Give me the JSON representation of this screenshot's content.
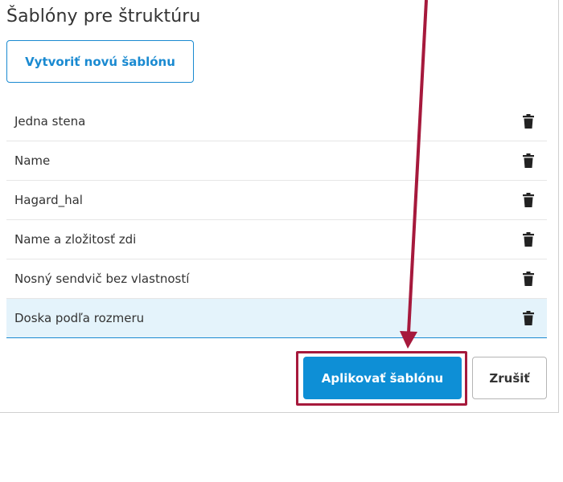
{
  "dialog": {
    "title": "Šablóny pre štruktúru",
    "create_button": "Vytvoriť novú šablónu",
    "templates": [
      {
        "label": "Jedna stena",
        "selected": false
      },
      {
        "label": "Name",
        "selected": false
      },
      {
        "label": "Hagard_hal",
        "selected": false
      },
      {
        "label": "Name a zložitosť zdi",
        "selected": false
      },
      {
        "label": "Nosný sendvič bez vlastností",
        "selected": false
      },
      {
        "label": "Doska podľa rozmeru",
        "selected": true
      }
    ],
    "apply_button": "Aplikovať šablónu",
    "cancel_button": "Zrušiť"
  },
  "colors": {
    "accent": "#0e8fd6",
    "selected_row": "#e4f3fb",
    "annotation": "#a6193c"
  },
  "icons": {
    "row_action": "trash-icon"
  }
}
